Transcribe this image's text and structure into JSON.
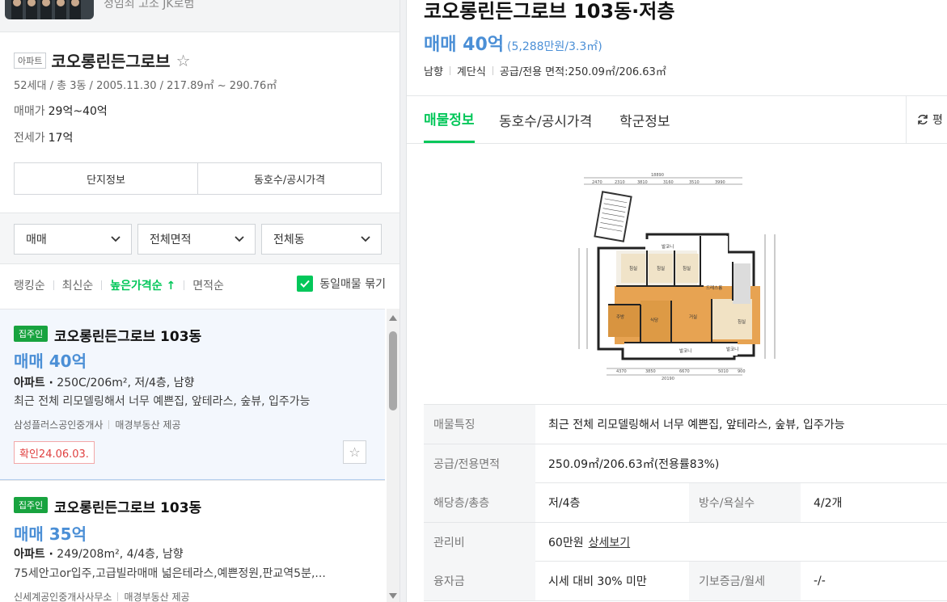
{
  "top": {
    "caption": "정임쇠 고조 JK로범"
  },
  "complex": {
    "type_tag": "아파트",
    "name": "코오롱린든그로브",
    "meta": "52세대 / 총 3동 / 2005.11.30 / 217.89㎡ ~ 290.76㎡",
    "sale_label": "매매가",
    "sale_value": "29억~40억",
    "jeonse_label": "전세가",
    "jeonse_value": "17억",
    "tabs": [
      "단지정보",
      "동호수/공시가격"
    ]
  },
  "filters": {
    "trade_type": "매매",
    "area": "전체면적",
    "building": "전체동"
  },
  "sort": {
    "options": [
      "랭킹순",
      "최신순",
      "높은가격순 ↑",
      "면적순"
    ],
    "active_index": 2,
    "group_label": "동일매물 묶기"
  },
  "listings": [
    {
      "badge": "집주인",
      "title": "코오롱린든그로브 103동",
      "price": "매매 40억",
      "spec_type": "아파트 ·",
      "spec": "250C/206m², 저/4층, 남향",
      "desc": "최근 전체 리모델링해서 너무 예쁜집, 앞테라스, 숲뷰, 입주가능",
      "agency": "삼성플러스공인중개사",
      "provider": "매경부동산 제공",
      "confirm": "확인24.06.03."
    },
    {
      "badge": "집주인",
      "title": "코오롱린든그로브 103동",
      "price": "매매 35억",
      "spec_type": "아파트 ·",
      "spec": "249/208m², 4/4층, 남향",
      "desc": "75세안고or입주,고급빌라매매 넓은테라스,예쁜정원,판교역5분,...",
      "agency": "신세계공인중개사사무소",
      "provider": "매경부동산 제공"
    }
  ],
  "detail": {
    "title": "코오롱린든그로브 103동·저층",
    "price": "매매 40억",
    "unit_price": "(5,288만원/3.3㎡)",
    "attrs": [
      "남향",
      "계단식",
      "공급/전용 면적:250.09㎡/206.63㎡"
    ],
    "tabs": [
      "매물정보",
      "동호수/공시가격",
      "학군정보"
    ],
    "refresh_label": "평",
    "floorplan_labels": {
      "dims_top": [
        "2470",
        "2310",
        "3810",
        "3160",
        "3510",
        "3990"
      ],
      "total_top": "18890",
      "dims_bottom": [
        "4370",
        "3850",
        "6670",
        "5010",
        "900"
      ],
      "total_bottom": "20190",
      "rooms": [
        "발코니",
        "침실",
        "침실",
        "침실",
        "드레스룸",
        "주방",
        "식당",
        "거실",
        "침실",
        "발코니",
        "발코니"
      ]
    },
    "table": [
      {
        "h1": "매물특징",
        "v1": "최근 전체 리모델링해서 너무 예쁜집, 앞테라스, 숲뷰, 입주가능"
      },
      {
        "h1": "공급/전용면적",
        "v1": "250.09㎡/206.63㎡(전용률83%)"
      },
      {
        "h1": "해당층/총층",
        "v1": "저/4층",
        "h2": "방수/욕실수",
        "v2": "4/2개"
      },
      {
        "h1": "관리비",
        "v1": "60만원",
        "link": "상세보기"
      },
      {
        "h1": "융자금",
        "v1": "시세 대비 30% 미만",
        "h2": "기보증금/월세",
        "v2": "-/-"
      }
    ]
  }
}
